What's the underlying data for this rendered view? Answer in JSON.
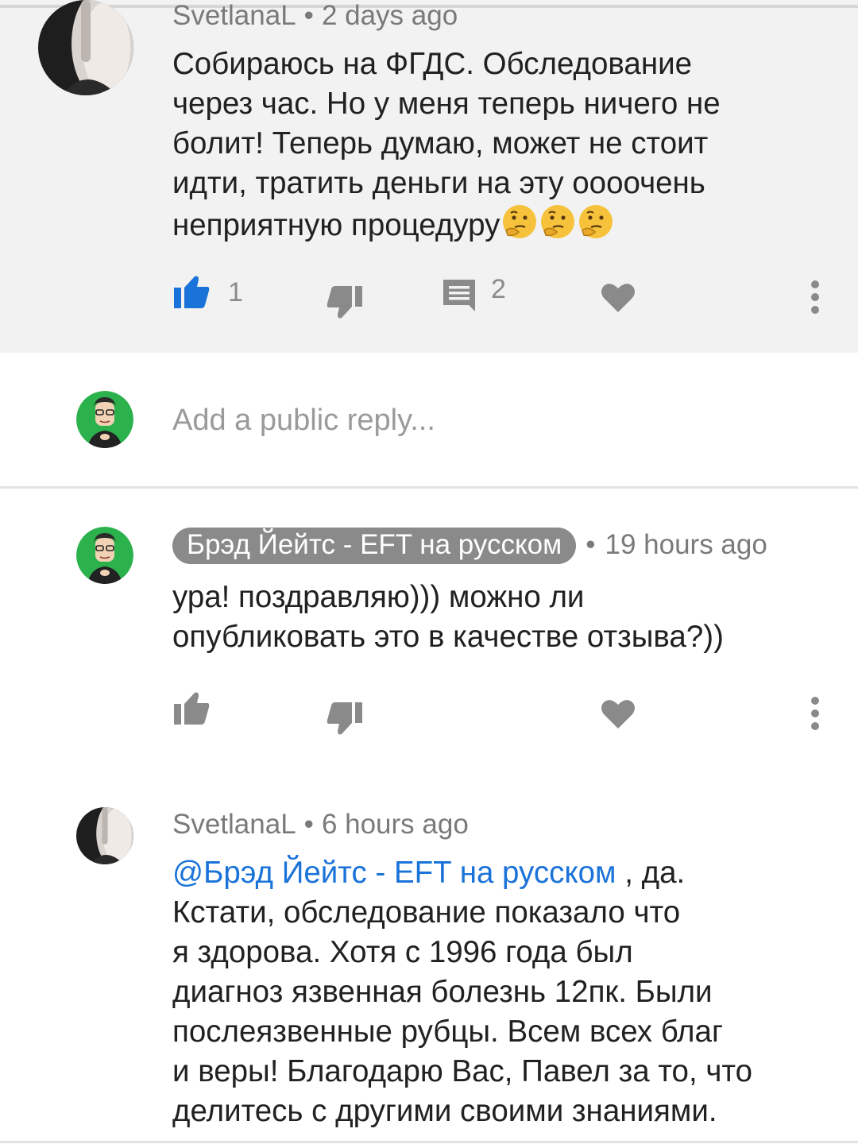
{
  "comments": [
    {
      "author": "SvetlanaL",
      "time": "2 days ago",
      "lines": [
        "Собираюсь на ФГДС. Обследование",
        "через час. Но у меня теперь ничего не",
        "болит! Теперь думаю, может не стоит",
        "идти, тратить деньги на эту оооочень",
        "неприятную процедуру"
      ],
      "emoji": [
        "thinking-face-emoji",
        "thinking-face-emoji",
        "thinking-face-emoji"
      ],
      "likes": "1",
      "replies": "2"
    },
    {
      "author": "Брэд Йейтс - EFT на русском",
      "time": "19 hours ago",
      "lines": [
        "ура! поздравляю))) можно ли",
        "опубликовать это в качестве отзыва?))"
      ]
    },
    {
      "author": "SvetlanaL",
      "time": "6 hours ago",
      "mention": "@Брэд Йейтс - EFT на русском",
      "first_line_rest": " , да.",
      "lines": [
        "Кстати, обследование показало что",
        "я здорова. Хотя с 1996 года был",
        "диагноз язвенная болезнь 12пк. Были",
        "послеязвенные рубцы.  Всем всех благ",
        "и веры! Благодарю Вас, Павел  за то, что",
        "делитесь с другими своими знаниями."
      ]
    }
  ],
  "reply_box": {
    "placeholder": "Add a public reply..."
  },
  "separator": "•",
  "icons": {
    "like": "thumb-up-icon",
    "dislike": "thumb-down-icon",
    "reply": "comment-icon",
    "heart": "heart-icon",
    "more": "more-vert-icon"
  },
  "colors": {
    "accent_blue": "#1a73d9",
    "highlight_bg": "#f2f2f2",
    "icon_gray": "#8a8a8a"
  }
}
